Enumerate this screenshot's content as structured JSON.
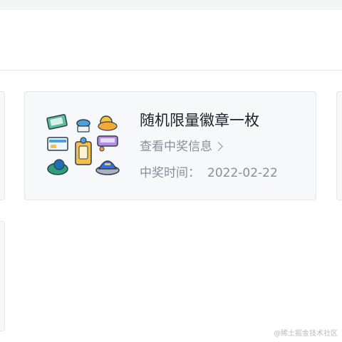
{
  "prize": {
    "title": "随机限量徽章一枚",
    "view_link": "查看中奖信息",
    "time_label": "中奖时间：",
    "time_value": "2022-02-22"
  },
  "watermark": "@稀土掘金技术社区",
  "icons": {
    "badge": "badge-collection-icon",
    "chevron": "chevron-right-icon"
  }
}
